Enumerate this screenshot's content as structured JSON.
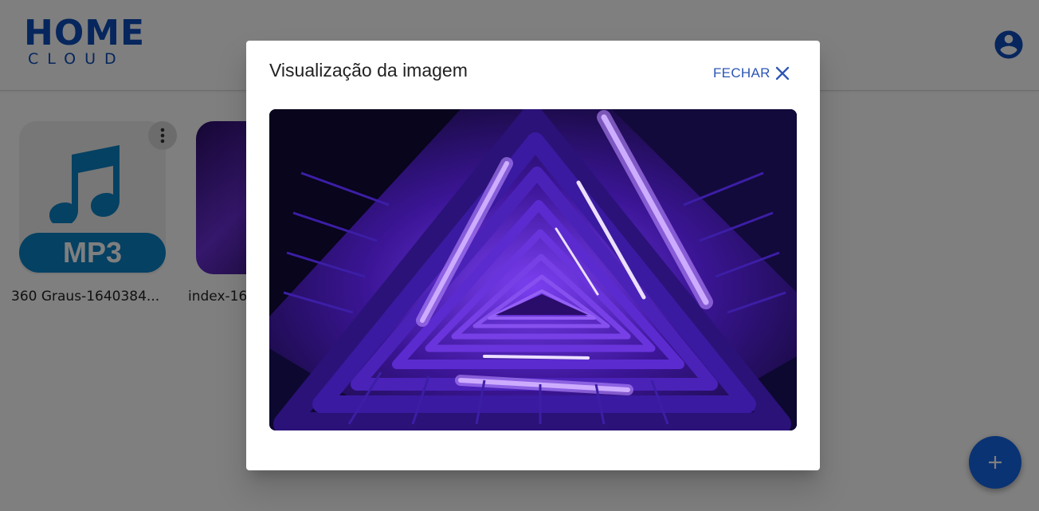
{
  "app": {
    "logo": {
      "line1": "HOME",
      "line2": "CLOUD"
    },
    "brand_color": "#0d4cba",
    "account_icon": "account-circle-icon"
  },
  "files": [
    {
      "name": "360 Graus-1640384...",
      "kind": "mp3",
      "badge": "MP3",
      "icon": "music-note-icon"
    },
    {
      "name": "index-16",
      "kind": "image"
    }
  ],
  "fab": {
    "icon": "plus-icon",
    "color": "#1466e6"
  },
  "dialog": {
    "title": "Visualização da imagem",
    "close_label": "FECHAR",
    "close_icon": "close-icon",
    "accent": "#2c56b4"
  }
}
